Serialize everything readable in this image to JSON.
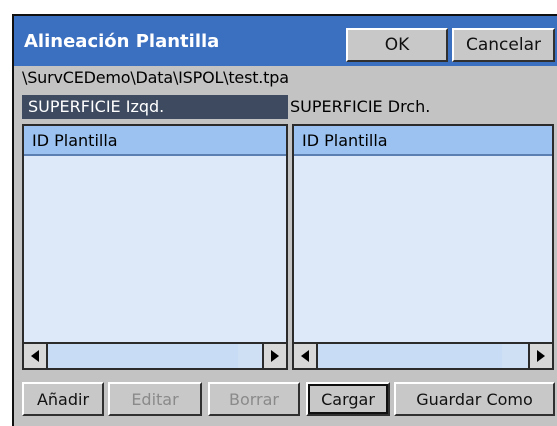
{
  "window": {
    "title": "Alineación Plantilla",
    "ok_label": "OK",
    "cancel_label": "Cancelar"
  },
  "file_path": "\\SurvCEDemo\\Data\\ISPOL\\test.tpa",
  "surfaces": {
    "left": "SUPERFICIE Izqd.",
    "right": "SUPERFICIE Drch."
  },
  "lists": {
    "left": {
      "column_header": "ID Plantilla",
      "rows": []
    },
    "right": {
      "column_header": "ID Plantilla",
      "rows": []
    }
  },
  "buttons": {
    "add": "Añadir",
    "edit": "Editar",
    "delete": "Borrar",
    "load": "Cargar",
    "save_as": "Guardar Como"
  },
  "colors": {
    "title_bar": "#3b6fc0",
    "selected_surface": "#3d4a5f",
    "list_header": "#9bc2f0",
    "list_body": "#dde9f9"
  }
}
